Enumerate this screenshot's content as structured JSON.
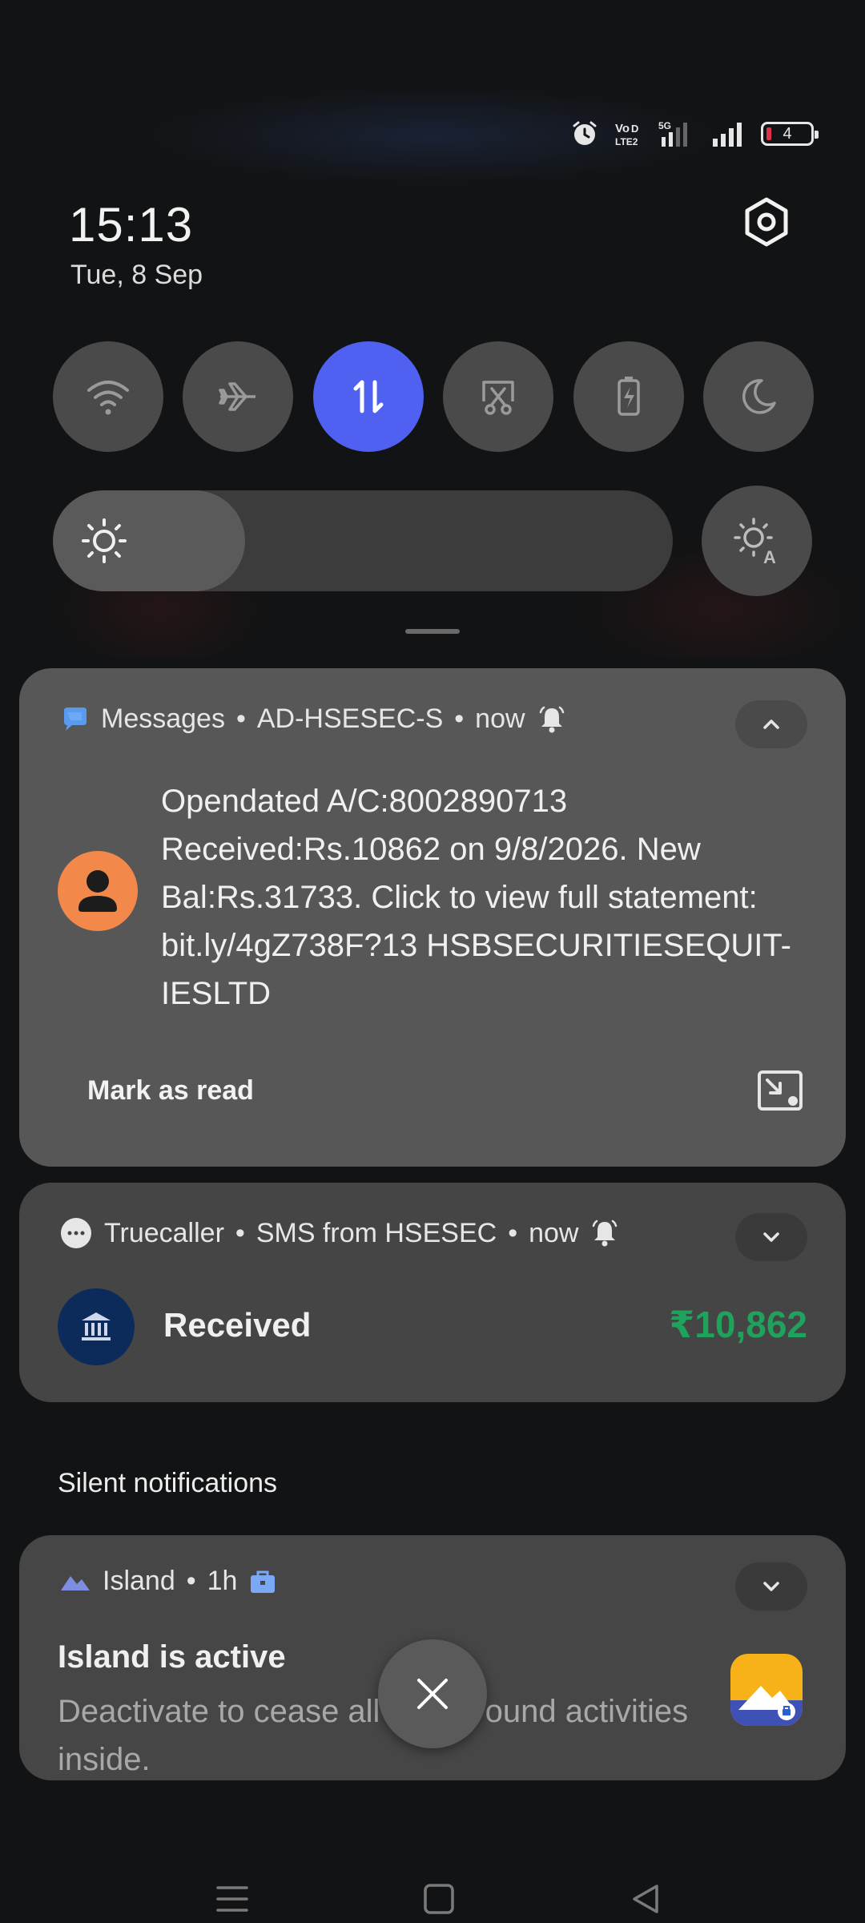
{
  "status_bar": {
    "icons": [
      "alarm-icon",
      "volte-icon",
      "5g-signal-icon",
      "signal-icon"
    ],
    "volte_label": "VoLTE",
    "network_label": "5G",
    "battery_level": "4",
    "battery_color": "#e0304a"
  },
  "header": {
    "time": "15:13",
    "date": "Tue, 8 Sep",
    "settings_icon": "gear-icon"
  },
  "quick_tiles": [
    {
      "name": "wifi",
      "icon": "wifi-icon",
      "active": false
    },
    {
      "name": "airplane",
      "icon": "airplane-icon",
      "active": false
    },
    {
      "name": "mobile-data",
      "icon": "data-arrows-icon",
      "active": true
    },
    {
      "name": "screenshot",
      "icon": "scissors-icon",
      "active": false
    },
    {
      "name": "battery-saver",
      "icon": "battery-icon",
      "active": false
    },
    {
      "name": "dark-mode",
      "icon": "moon-icon",
      "active": false
    }
  ],
  "brightness": {
    "level": 0.31,
    "auto_icon": "auto-brightness-icon"
  },
  "accent_color": "#5060f0",
  "notifications": [
    {
      "app": "Messages",
      "sender": "AD-HSESEC-S",
      "time": "now",
      "app_icon": "messages-icon",
      "body": "Opendated A/C:8002890713 Received:Rs.10862 on 9/8/2026. New Bal:Rs.31733. Click to view full statement: bit.ly/4gZ738F?13 HSBSECURITIESEQUIT-IESLTD",
      "action": "Mark as read"
    },
    {
      "app": "Truecaller",
      "sender": "SMS from HSESEC",
      "time": "now",
      "app_icon": "truecaller-icon",
      "title": "Received",
      "amount": "₹10,862",
      "amount_color": "#1fa35c"
    }
  ],
  "silent_label": "Silent notifications",
  "silent_notifications": [
    {
      "app": "Island",
      "time": "1h",
      "app_icon": "island-icon",
      "title": "Island is active",
      "body": "Deactivate to cease all background activities inside."
    }
  ],
  "nav": {
    "menu_icon": "menu-icon",
    "home_icon": "home-icon",
    "back_icon": "back-icon"
  }
}
